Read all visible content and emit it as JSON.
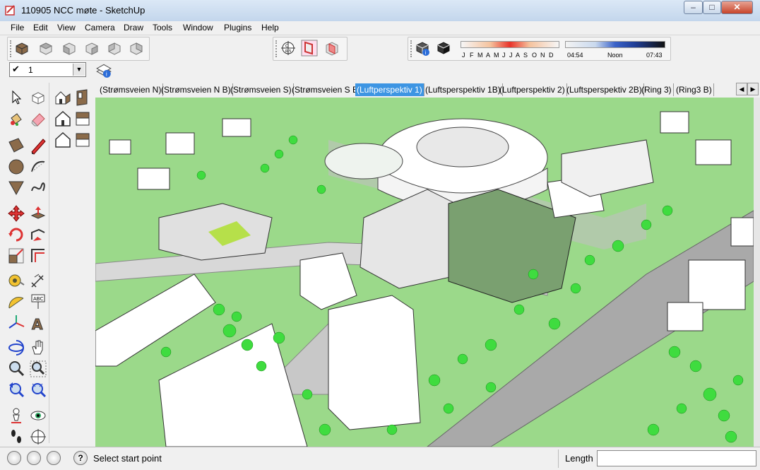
{
  "window": {
    "title": "110905 NCC møte - SketchUp",
    "controls": {
      "minimize": "–",
      "maximize": "□",
      "close": "✕"
    }
  },
  "menu": [
    "File",
    "Edit",
    "View",
    "Camera",
    "Draw",
    "Tools",
    "Window",
    "Plugins",
    "Help"
  ],
  "layer": {
    "check": "✔",
    "name": "1"
  },
  "shadow": {
    "months": [
      "J",
      "F",
      "M",
      "A",
      "M",
      "J",
      "J",
      "A",
      "S",
      "O",
      "N",
      "D"
    ],
    "time_start": "04:54",
    "time_noon": "Noon",
    "time_end": "07:43"
  },
  "scenes": {
    "tabs": [
      "(Strømsveien N)",
      "(Strømsveien N B)",
      "(Strømsveien S)",
      "(Strømsveien S B)",
      "(Luftperspektiv 1)",
      "(Luftsperspektiv 1B)",
      "(Luftperspektiv 2)",
      "(Luftsperspektiv 2B)",
      "(Ring 3)",
      "(Ring3 B)"
    ],
    "active_index": 4
  },
  "status": {
    "message": "Select start point",
    "help_icon": "?",
    "length_label": "Length",
    "length_value": ""
  },
  "colors": {
    "ground": "#9bd98a",
    "road": "#a9a9a9",
    "tree": "#3fdc3f",
    "building": "#ffffff",
    "tab_active": "#3d95e3"
  }
}
